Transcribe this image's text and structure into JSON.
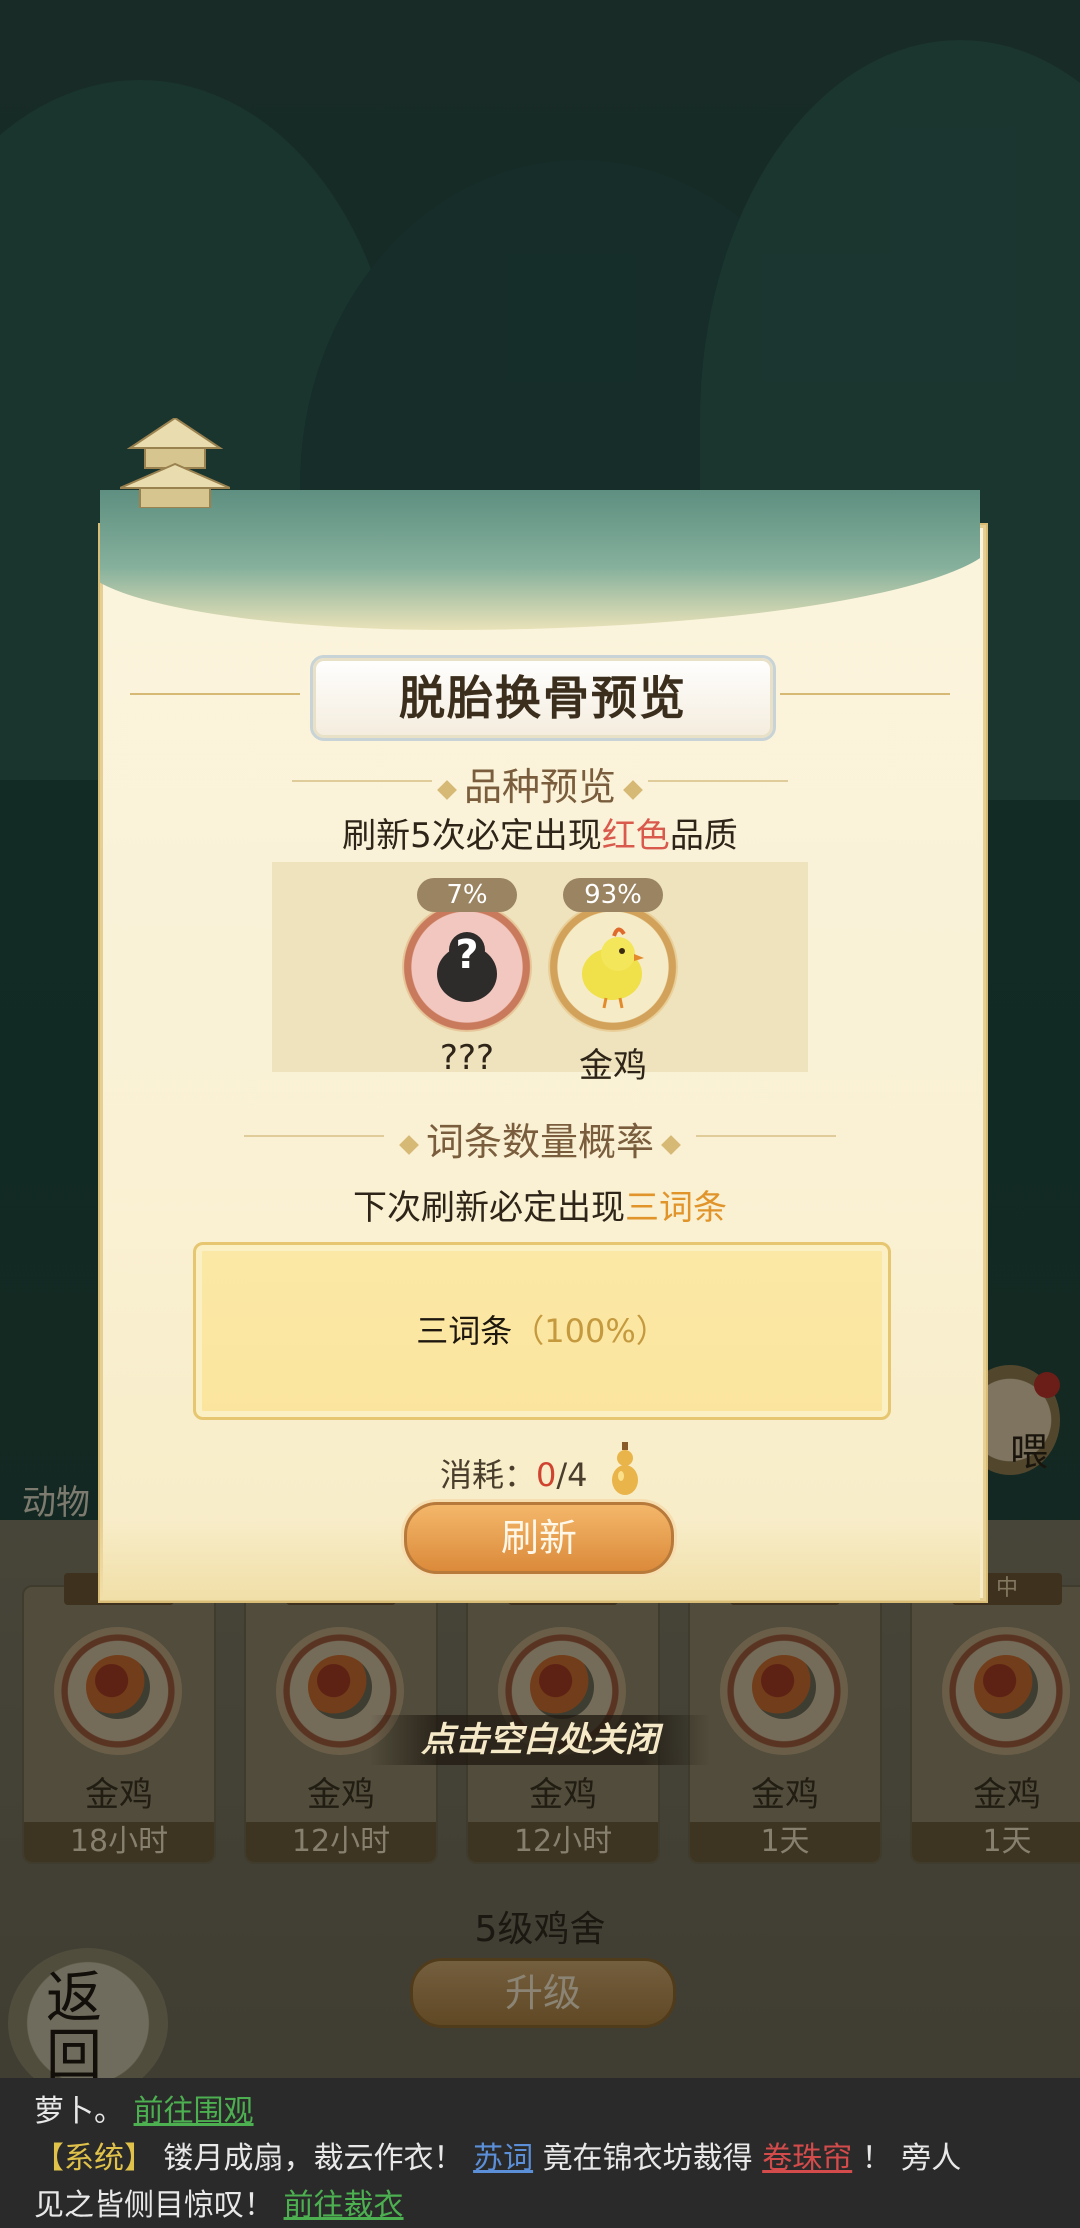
{
  "modal": {
    "title": "脱胎换骨预览",
    "breed_section": "品种预览",
    "breed_desc_prefix": "刷新5次必定出现",
    "breed_desc_highlight": "红色",
    "breed_desc_suffix": "品质",
    "breeds": [
      {
        "percent": "7%",
        "name": "???",
        "icon": "unknown-chick-icon"
      },
      {
        "percent": "93%",
        "name": "金鸡",
        "icon": "golden-chick-icon"
      }
    ],
    "count_section": "词条数量概率",
    "count_desc_prefix": "下次刷新必定出现",
    "count_desc_highlight": "三词条",
    "prob_label": "三词条",
    "prob_value": "（100%）",
    "cost_label": "消耗：",
    "cost_current": "0",
    "cost_total": "/4",
    "refresh_label": "刷新",
    "close_hint": "点击空白处关闭"
  },
  "farm": {
    "animal_tab": "动物",
    "feed_label": "喂",
    "cards": [
      {
        "tag": "",
        "name": "金鸡",
        "time": "18小时"
      },
      {
        "tag": "",
        "name": "金鸡",
        "time": "12小时"
      },
      {
        "tag": "",
        "name": "金鸡",
        "time": "12小时"
      },
      {
        "tag": "",
        "name": "金鸡",
        "time": "1天"
      },
      {
        "tag": "中",
        "name": "金鸡",
        "time": "1天"
      }
    ],
    "level_text": "5级鸡舍",
    "upgrade_label": "升级",
    "back_label": "返回"
  },
  "chat": {
    "line1_text": "萝卜。",
    "line1_link": "前往围观",
    "line2_sys": "【系统】",
    "line2_text1": "镂月成扇，裁云作衣！",
    "line2_name": "苏词",
    "line2_text2": "竟在锦衣坊裁得",
    "line2_item": "卷珠帘",
    "line2_text3": "！ 旁人",
    "line3_text": "见之皆侧目惊叹！",
    "line3_link": "前往裁衣"
  },
  "colors": {
    "accent_red": "#d95a4c",
    "accent_orange": "#e0942a",
    "refresh_orange": "#db8a3a"
  }
}
